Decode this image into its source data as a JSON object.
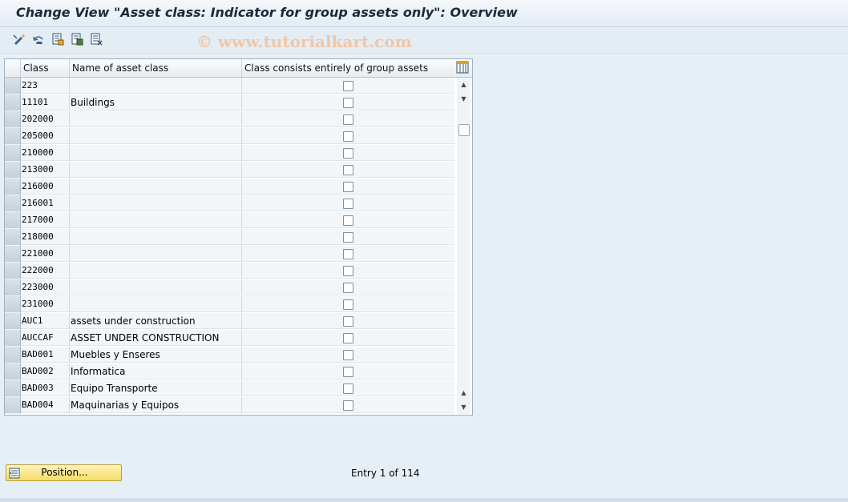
{
  "window": {
    "title": "Change View \"Asset class: Indicator for group assets only\": Overview",
    "watermark": "© www.tutorialkart.com"
  },
  "toolbar": {
    "icons": [
      "display-change-icon",
      "undo-icon",
      "new-entries-icon",
      "copy-as-icon",
      "delete-icon"
    ]
  },
  "table": {
    "columns": [
      "Class",
      "Name of asset class",
      "Class consists entirely of group assets"
    ],
    "rows": [
      {
        "class": "223",
        "name": "",
        "checked": false
      },
      {
        "class": "11101",
        "name": "Buildings",
        "checked": false
      },
      {
        "class": "202000",
        "name": "",
        "checked": false
      },
      {
        "class": "205000",
        "name": "",
        "checked": false
      },
      {
        "class": "210000",
        "name": "",
        "checked": false
      },
      {
        "class": "213000",
        "name": "",
        "checked": false
      },
      {
        "class": "216000",
        "name": "",
        "checked": false
      },
      {
        "class": "216001",
        "name": "",
        "checked": false
      },
      {
        "class": "217000",
        "name": "",
        "checked": false
      },
      {
        "class": "218000",
        "name": "",
        "checked": false
      },
      {
        "class": "221000",
        "name": "",
        "checked": false
      },
      {
        "class": "222000",
        "name": "",
        "checked": false
      },
      {
        "class": "223000",
        "name": "",
        "checked": false
      },
      {
        "class": "231000",
        "name": "",
        "checked": false
      },
      {
        "class": "AUC1",
        "name": "assets under construction",
        "checked": false
      },
      {
        "class": "AUCCAF",
        "name": "ASSET UNDER CONSTRUCTION",
        "checked": false
      },
      {
        "class": "BAD001",
        "name": "Muebles y Enseres",
        "checked": false
      },
      {
        "class": "BAD002",
        "name": "Informatica",
        "checked": false
      },
      {
        "class": "BAD003",
        "name": "Equipo Transporte",
        "checked": false
      },
      {
        "class": "BAD004",
        "name": "Maquinarias y Equipos",
        "checked": false
      }
    ]
  },
  "footer": {
    "position_label": "Position...",
    "entry_text": "Entry 1 of 114"
  }
}
